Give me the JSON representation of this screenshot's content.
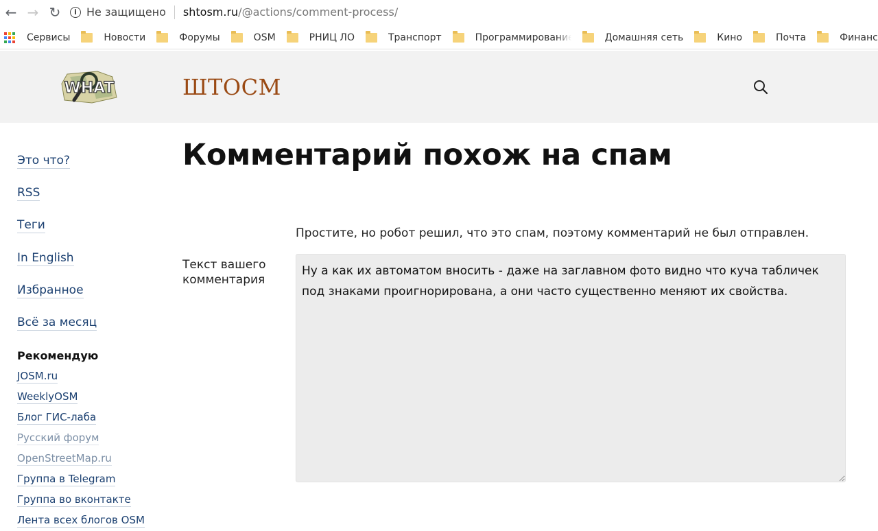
{
  "browser": {
    "back_glyph": "←",
    "forward_glyph": "→",
    "reload_glyph": "↻",
    "info_glyph": "i",
    "security_label": "Не защищено",
    "url_host": "shtosm.ru",
    "url_path": "/@actions/comment-process/",
    "apps_colors": [
      "#ea4335",
      "#fbbc05",
      "#34a853",
      "#4285f4",
      "#ea4335",
      "#fbbc05",
      "#34a853",
      "#4285f4",
      "#ea4335"
    ],
    "bookmarks": [
      "Сервисы",
      "Новости",
      "Форумы",
      "OSM",
      "РНИЦ ЛО",
      "Транспорт",
      "Программирование",
      "Домашняя сеть",
      "Кино",
      "Почта",
      "Финансы"
    ]
  },
  "header": {
    "site_title": "ШТОСМ",
    "logo_text": "WHAT",
    "search_icon": "magnifier"
  },
  "sidebar": {
    "links": [
      "Это что?",
      "RSS",
      "Теги",
      "In English",
      "Избранное",
      "Всё за месяц"
    ],
    "recommend_heading": "Рекомендую",
    "recommend": [
      {
        "label": "JOSM.ru",
        "muted": false
      },
      {
        "label": "WeeklyOSM",
        "muted": false
      },
      {
        "label": "Блог ГИС-лаба",
        "muted": false
      },
      {
        "label": "Русский форум",
        "muted": true
      },
      {
        "label": "OpenStreetMap.ru",
        "muted": true
      },
      {
        "label": "Группа в Telegram",
        "muted": false
      },
      {
        "label": "Группа во вконтакте",
        "muted": false
      },
      {
        "label": "Лента всех блогов OSM",
        "muted": false
      }
    ]
  },
  "main": {
    "page_title": "Комментарий похож на спам",
    "spam_message": "Простите, но робот решил, что это спам, поэтому комментарий не был отправлен.",
    "field_label": "Текст вашего комментария",
    "comment_text": "Ну а как их автоматом вносить - даже на заглавном фото видно что куча табличек под знаками проигнорирована, а они часто существенно меняют их свойства."
  },
  "colors": {
    "site_title": "#9a4a14",
    "link": "#1a3f70",
    "muted_link": "#7c8fa6",
    "header_bg": "#f2f2f2",
    "textarea_bg": "#ececec"
  }
}
